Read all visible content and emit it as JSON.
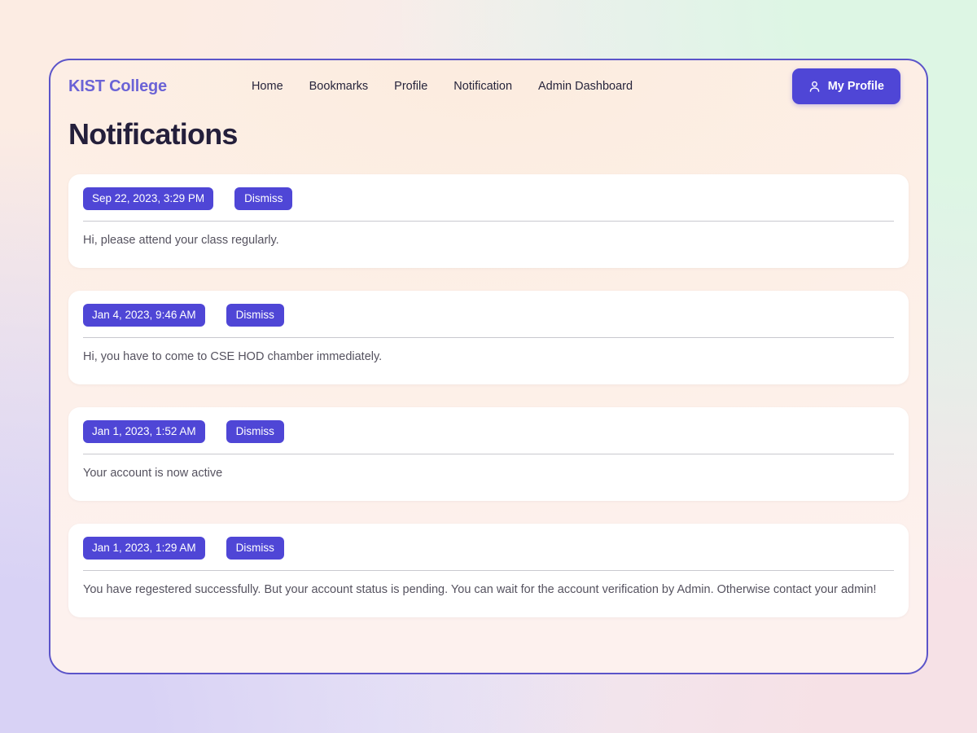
{
  "header": {
    "brand": "KIST College",
    "nav_links": [
      {
        "label": "Home"
      },
      {
        "label": "Bookmarks"
      },
      {
        "label": "Profile"
      },
      {
        "label": "Notification"
      },
      {
        "label": "Admin Dashboard"
      }
    ],
    "profile_button": {
      "label": "My Profile",
      "icon": "person-icon"
    }
  },
  "main": {
    "page_title": "Notifications",
    "dismiss_label": "Dismiss",
    "notifications": [
      {
        "timestamp": "Sep 22, 2023, 3:29 PM",
        "message": "Hi, please attend your class regularly.",
        "dismiss_label": "Dismiss"
      },
      {
        "timestamp": "Jan 4, 2023, 9:46 AM",
        "message": "Hi, you have to come to CSE HOD chamber immediately.",
        "dismiss_label": "Dismiss"
      },
      {
        "timestamp": "Jan 1, 2023, 1:52 AM",
        "message": "Your account is now active",
        "dismiss_label": "Dismiss"
      },
      {
        "timestamp": "Jan 1, 2023, 1:29 AM",
        "message": "You have regestered successfully. But your account status is pending. You can wait for the account verification by Admin. Otherwise contact your admin!",
        "dismiss_label": "Dismiss"
      }
    ]
  },
  "theme": {
    "accent": "#4f46d6",
    "brand_color": "#6b63d6",
    "panel_border": "#5b54c9",
    "title_color": "#241f3b",
    "message_color": "#55525f",
    "card_bg": "#ffffff"
  }
}
